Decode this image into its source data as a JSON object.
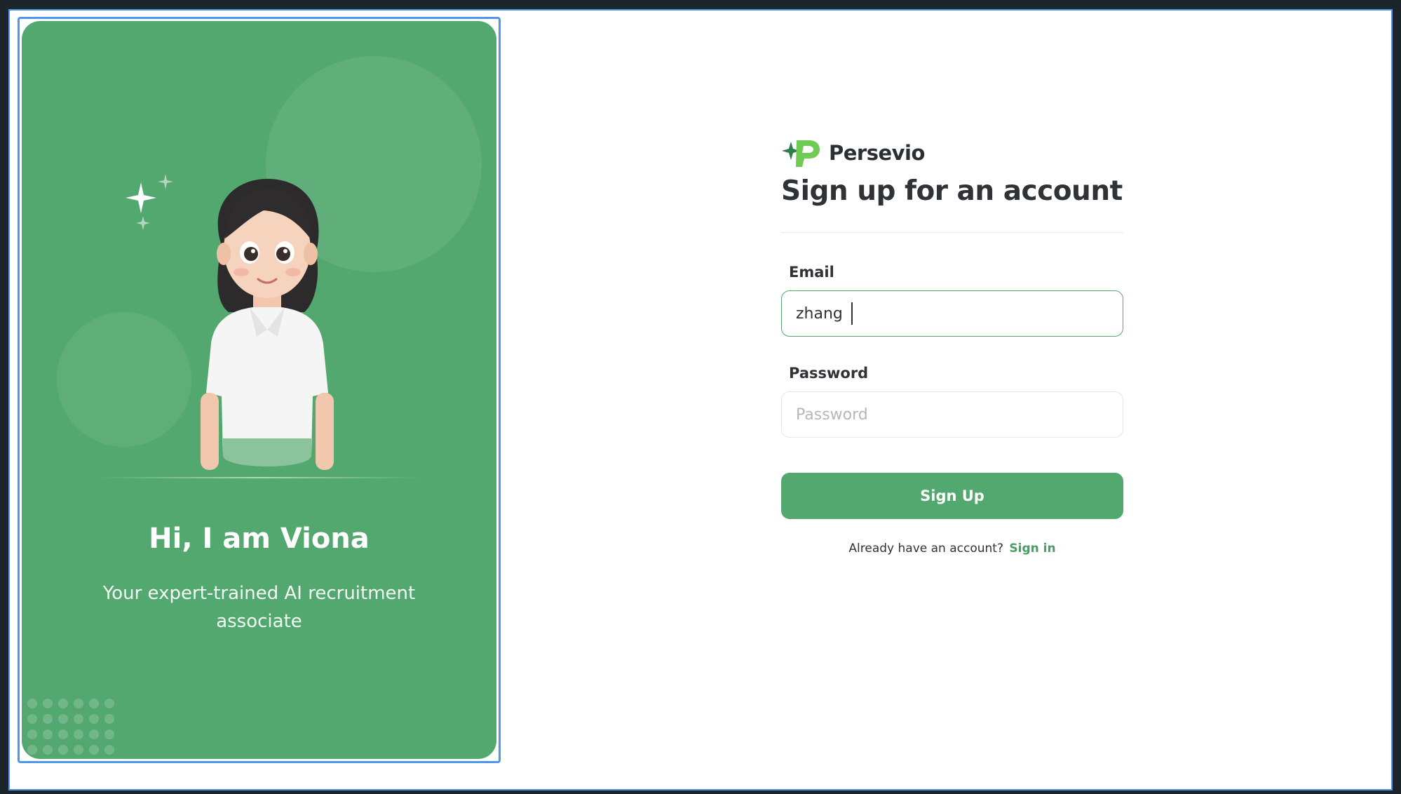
{
  "hero": {
    "title": "Hi, I am Viona",
    "subtitle": "Your expert-trained AI recruitment associate",
    "background_color": "#53a86f"
  },
  "brand": {
    "name": "Persevio",
    "logo_icon": "persevio-logo-icon",
    "accent_color": "#53a86f"
  },
  "form": {
    "title": "Sign up for an account",
    "email": {
      "label": "Email",
      "value": "zhang"
    },
    "password": {
      "label": "Password",
      "placeholder": "Password"
    },
    "submit_label": "Sign Up",
    "signin_prompt": "Already have an account?",
    "signin_link": "Sign in"
  }
}
